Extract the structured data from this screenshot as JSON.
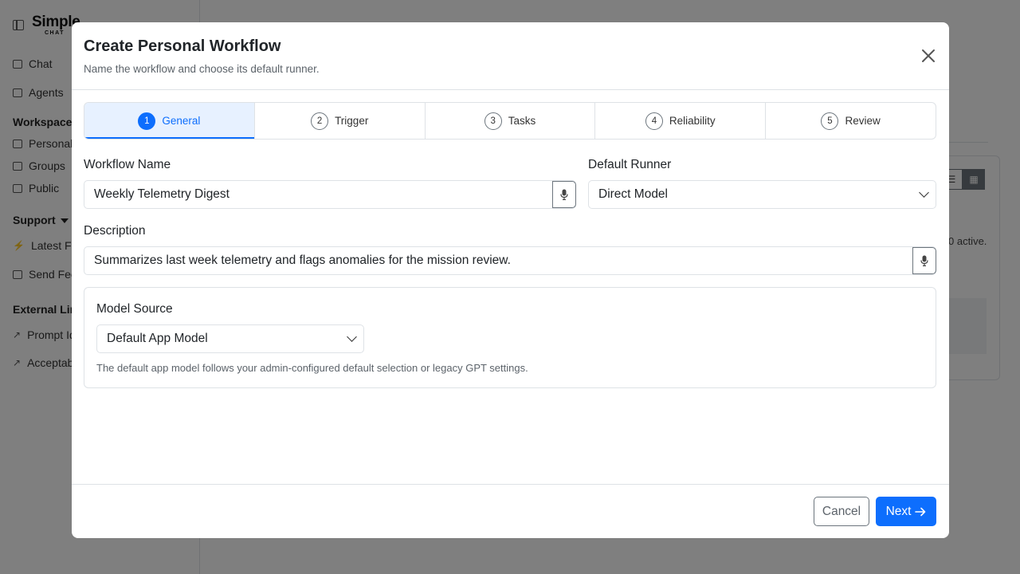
{
  "sidebar": {
    "brand_name": "Simple",
    "brand_sub": "CHAT",
    "items": [
      {
        "label": "Chat",
        "icon": "chat-icon"
      },
      {
        "label": "Agents",
        "icon": "robot-icon"
      }
    ],
    "workspaces_heading": "Workspaces",
    "workspaces": [
      {
        "label": "Personal",
        "icon": "folder-icon"
      },
      {
        "label": "Groups",
        "icon": "folder-icon"
      },
      {
        "label": "Public",
        "icon": "folder-icon"
      }
    ],
    "support_heading": "Support",
    "support_items": [
      {
        "label": "Latest Fea",
        "icon": "lightning-icon"
      },
      {
        "label": "Send Feed",
        "icon": "inbox-icon"
      }
    ],
    "external_heading": "External Lin",
    "external_items": [
      {
        "label": "Prompt Id",
        "icon": "external-link-icon"
      },
      {
        "label": "Acceptab",
        "icon": "external-link-icon"
      }
    ]
  },
  "background": {
    "active_text": "0 active."
  },
  "modal": {
    "title": "Create Personal Workflow",
    "subtitle": "Name the workflow and choose its default runner.",
    "steps": [
      {
        "num": "1",
        "label": "General",
        "active": true
      },
      {
        "num": "2",
        "label": "Trigger",
        "active": false
      },
      {
        "num": "3",
        "label": "Tasks",
        "active": false
      },
      {
        "num": "4",
        "label": "Reliability",
        "active": false
      },
      {
        "num": "5",
        "label": "Review",
        "active": false
      }
    ],
    "workflow_name_label": "Workflow Name",
    "workflow_name_value": "Weekly Telemetry Digest",
    "default_runner_label": "Default Runner",
    "default_runner_value": "Direct Model",
    "description_label": "Description",
    "description_value": "Summarizes last week telemetry and flags anomalies for the mission review.",
    "model_source_label": "Model Source",
    "model_source_value": "Default App Model",
    "model_source_help": "The default app model follows your admin-configured default selection or legacy GPT settings.",
    "cancel_label": "Cancel",
    "next_label": "Next",
    "accent_color": "#0d6efd"
  }
}
